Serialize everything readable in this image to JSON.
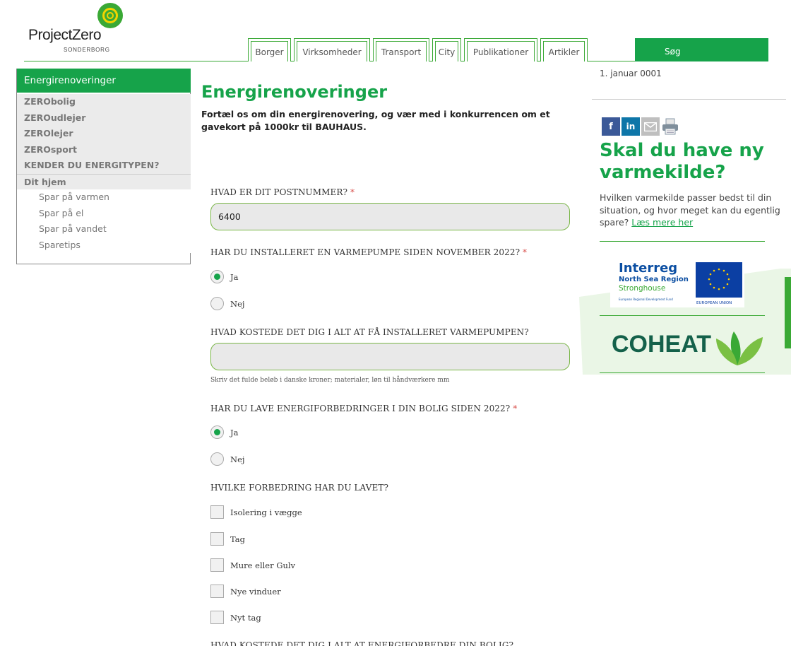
{
  "logo": {
    "name": "ProjectZero",
    "sub": "SONDERBORG"
  },
  "tabs": [
    "Borger",
    "Virksomheder",
    "Transport",
    "City",
    "Publikationer",
    "Artikler"
  ],
  "search_label": "Søg",
  "sidebar": {
    "title": "Energirenoveringer",
    "items": [
      "ZERObolig",
      "ZEROudlejer",
      "ZEROlejer",
      "ZEROsport",
      "KENDER DU ENERGITYPEN?",
      "Dit hjem"
    ],
    "subitems": [
      "Spar på varmen",
      "Spar på el",
      "Spar på vandet",
      "Sparetips"
    ]
  },
  "page": {
    "title": "Energirenoveringer",
    "intro": "Fortæl os om din energirenovering, og vær med i konkurrencen om et gavekort på 1000kr til BAUHAUS."
  },
  "form": {
    "q1": {
      "label": "HVAD ER DIT POSTNUMMER?",
      "required": "*",
      "value": "6400"
    },
    "q2": {
      "label": "HAR DU INSTALLERET EN VARMEPUMPE SIDEN NOVEMBER 2022?",
      "required": "*",
      "options": [
        "Ja",
        "Nej"
      ],
      "selected": "Ja"
    },
    "q3": {
      "label": "HVAD KOSTEDE DET DIG I ALT AT FÅ INSTALLERET VARMEPUMPEN?",
      "value": "",
      "hint": "Skriv det fulde beløb i danske kroner; materialer, løn til håndværkere mm"
    },
    "q4": {
      "label": "HAR DU LAVE ENERGIFORBEDRINGER I DIN BOLIG SIDEN 2022?",
      "required": "*",
      "options": [
        "Ja",
        "Nej"
      ],
      "selected": "Ja"
    },
    "q5": {
      "label": "HVILKE FORBEDRING HAR DU LAVET?",
      "options": [
        "Isolering i vægge",
        "Tag",
        "Mure eller Gulv",
        "Nye vinduer",
        "Nyt tag"
      ]
    },
    "q6": {
      "label": "HVAD KOSTEDE DET DIG I ALT AT ENERGIFORBEDRE DIN BOLIG?"
    }
  },
  "right": {
    "date": "1. januar 0001",
    "share": {
      "facebook": "f",
      "linkedin": "in"
    },
    "promo_title": "Skal du have ny varmekilde?",
    "promo_text": "Hvilken varmekilde passer bedst til din situation, og hvor meget kan du egentlig spare?",
    "promo_link": "Læs mere her",
    "interreg": {
      "title": "Interreg",
      "region": "North Sea Region",
      "project": "Stronghouse",
      "fund": "European Regional Development Fund",
      "eu": "EUROPEAN UNION"
    },
    "coheat": "COHEAT"
  },
  "colors": {
    "brand_green": "#16a34a",
    "accent_green": "#3aa935",
    "required_red": "#d9534f"
  }
}
